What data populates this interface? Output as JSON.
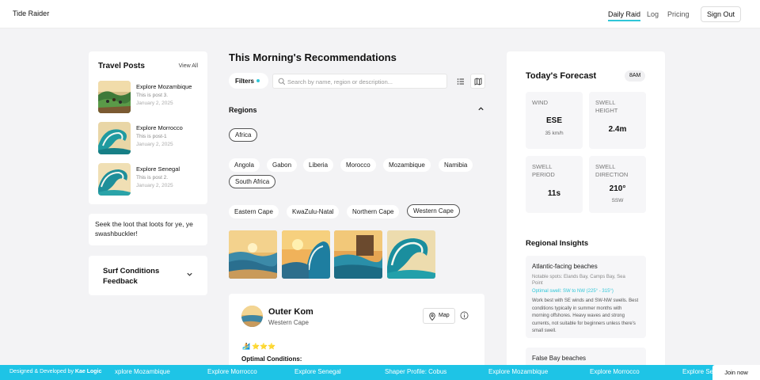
{
  "header": {
    "brand": "Tide Raider",
    "nav": [
      {
        "label": "Daily Raid"
      },
      {
        "label": "Log"
      },
      {
        "label": "Pricing"
      }
    ],
    "sign_out": "Sign Out"
  },
  "travel_posts": {
    "title": "Travel Posts",
    "view_all": "View All",
    "items": [
      {
        "title": "Explore Mozambique",
        "excerpt": "This is post 3.",
        "date": "January 2, 2025"
      },
      {
        "title": "Explore Morrocco",
        "excerpt": "This is post-1",
        "date": "January 2, 2025"
      },
      {
        "title": "Explore Senegal",
        "excerpt": "This is post 2.",
        "date": "January 2, 2025"
      }
    ]
  },
  "quote": "Seek the loot that loots for ye, ye swashbuckler!",
  "feedback": {
    "title": "Surf Conditions Feedback"
  },
  "main": {
    "title": "This Morning's Recommendations",
    "filters_label": "Filters",
    "search_placeholder": "Search by name, region or description...",
    "regions_label": "Regions",
    "continents": [
      "Africa"
    ],
    "countries": [
      "Angola",
      "Gabon",
      "Liberia",
      "Morocco",
      "Mozambique",
      "Namibia",
      "South Africa"
    ],
    "provinces": [
      "Eastern Cape",
      "KwaZulu-Natal",
      "Northern Cape",
      "Western Cape"
    ]
  },
  "spot": {
    "name": "Outer Kom",
    "region": "Western Cape",
    "map_label": "Map",
    "rating_icons": "🏄 ⭐⭐⭐",
    "optimal_heading": "Optimal Conditions:"
  },
  "forecast": {
    "title": "Today's Forecast",
    "time": "8AM",
    "stats": [
      {
        "label": "WIND",
        "value": "ESE",
        "sub": "35 km/h"
      },
      {
        "label": "SWELL HEIGHT",
        "value": "2.4m",
        "sub": ""
      },
      {
        "label": "SWELL PERIOD",
        "value": "11s",
        "sub": ""
      },
      {
        "label": "SWELL DIRECTION",
        "value": "210°",
        "sub": "SSW"
      }
    ]
  },
  "insights": {
    "title": "Regional Insights",
    "cards": [
      {
        "name": "Atlantic-facing beaches",
        "spots": "Notable spots: Elands Bay, Camps Bay, Sea Point",
        "swell": "Optimal swell: SW to NW (225° - 315°)",
        "desc": "Work best with SE winds and SW-NW swells. Best conditions typically in summer months with morning offshores. Heavy waves and strong currents, not suitable for beginners unless there's small swell."
      },
      {
        "name": "False Bay beaches"
      }
    ]
  },
  "ticker": {
    "credit_prefix": "Designed & Developed by",
    "credit_name": "Kae Logic",
    "items": [
      "xplore Mozambique",
      "Explore Morrocco",
      "Explore Senegal",
      "Shaper Profile: Cobus",
      "Explore Mozambique",
      "Explore Morrocco",
      "Explore Se"
    ],
    "join": "Join now"
  },
  "colors": {
    "accent": "#2fc6d8",
    "ticker_bg": "#1ec4e6"
  }
}
